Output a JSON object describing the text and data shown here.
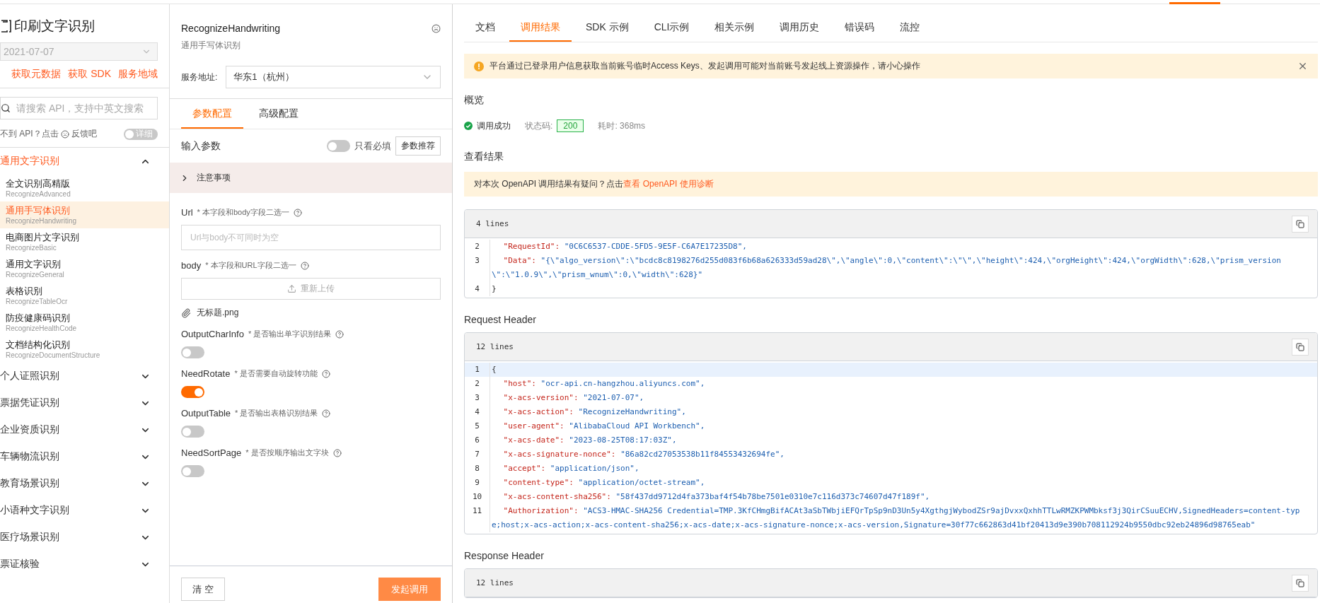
{
  "sidebar": {
    "product_title": "印刷文字识别",
    "version": "2021-07-07",
    "links": [
      "获取元数据",
      "获取 SDK",
      "服务地域"
    ],
    "search": {
      "placeholder": "请搜索 API，支持中英文搜索"
    },
    "feedback": {
      "prefix": "不到 API？点击",
      "suffix": "反馈吧"
    },
    "detail_toggle": {
      "label": "详细",
      "on": false
    },
    "groups": [
      {
        "label": "通用文字识别",
        "expanded": true,
        "children": [
          {
            "title": "全文识别高精版",
            "api": "RecognizeAdvanced",
            "selected": false
          },
          {
            "title": "通用手写体识别",
            "api": "RecognizeHandwriting",
            "selected": true
          },
          {
            "title": "电商图片文字识别",
            "api": "RecognizeBasic",
            "selected": false
          },
          {
            "title": "通用文字识别",
            "api": "RecognizeGeneral",
            "selected": false
          },
          {
            "title": "表格识别",
            "api": "RecognizeTableOcr",
            "selected": false
          },
          {
            "title": "防疫健康码识别",
            "api": "RecognizeHealthCode",
            "selected": false
          },
          {
            "title": "文档结构化识别",
            "api": "RecognizeDocumentStructure",
            "selected": false
          }
        ]
      },
      {
        "label": "个人证照识别",
        "expanded": false
      },
      {
        "label": "票据凭证识别",
        "expanded": false
      },
      {
        "label": "企业资质识别",
        "expanded": false
      },
      {
        "label": "车辆物流识别",
        "expanded": false
      },
      {
        "label": "教育场景识别",
        "expanded": false
      },
      {
        "label": "小语种文字识别",
        "expanded": false
      },
      {
        "label": "医疗场景识别",
        "expanded": false
      },
      {
        "label": "票证核验",
        "expanded": false
      }
    ]
  },
  "api_panel": {
    "title": "RecognizeHandwriting",
    "subtitle": "通用手写体识别",
    "endpoint": {
      "label": "服务地址:",
      "value": "华东1（杭州）"
    },
    "tabs": [
      {
        "label": "参数配置",
        "selected": true
      },
      {
        "label": "高级配置",
        "selected": false
      }
    ],
    "input_params": {
      "label": "输入参数",
      "required_only": {
        "label": "只看必填",
        "on": false
      },
      "recommend_button": "参数推荐"
    },
    "notes": {
      "label": "注意事项",
      "expanded": false
    },
    "params": [
      {
        "kind": "text",
        "name": "Url",
        "note": "* 本字段和body字段二选一",
        "placeholder": "Url与body不可同时为空"
      },
      {
        "kind": "file",
        "name": "body",
        "note": "* 本字段和URL字段二选一",
        "button": "重新上传",
        "file": "无标题.png"
      },
      {
        "kind": "switch",
        "name": "OutputCharInfo",
        "note": "* 是否输出单字识别结果",
        "on": false
      },
      {
        "kind": "switch",
        "name": "NeedRotate",
        "note": "* 是否需要自动旋转功能",
        "on": true
      },
      {
        "kind": "switch",
        "name": "OutputTable",
        "note": "* 是否输出表格识别结果",
        "on": false
      },
      {
        "kind": "switch",
        "name": "NeedSortPage",
        "note": "* 是否按顺序输出文字块",
        "on": false
      }
    ],
    "buttons": {
      "clear": "清 空",
      "invoke": "发起调用"
    }
  },
  "result_panel": {
    "tabs": [
      {
        "label": "文档",
        "selected": false
      },
      {
        "label": "调用结果",
        "selected": true
      },
      {
        "label": "SDK 示例",
        "selected": false
      },
      {
        "label": "CLI示例",
        "selected": false
      },
      {
        "label": "相关示例",
        "selected": false
      },
      {
        "label": "调用历史",
        "selected": false
      },
      {
        "label": "错误码",
        "selected": false
      },
      {
        "label": "流控",
        "selected": false
      }
    ],
    "warning": "平台通过已登录用户信息获取当前账号临时Access Keys、发起调用可能对当前账号发起线上资源操作，请小心操作",
    "overview": {
      "title": "概览",
      "status": "调用成功",
      "status_code_label": "状态码:",
      "status_code": "200",
      "elapsed": "耗时: 368ms"
    },
    "results_title": "查看结果",
    "diagnosis": {
      "text": "对本次 OpenAPI 调用结果有疑问？点击",
      "link": "查看 OpenAPI 使用诊断"
    },
    "blocks": [
      {
        "line_count": "4 lines",
        "lines": [
          {
            "number": "2",
            "kind": "pair",
            "key": "\"RequestId\":",
            "value": "\"0C6C6537-CDDE-5FD5-9E5F-C6A7E17235D8\","
          },
          {
            "number": "3",
            "kind": "pair",
            "key": "\"Data\":",
            "value": "\"{\\\"algo_version\\\":\\\"bcdc8c8198276d255d083f6b68a626333d59ad28\\\",\\\"angle\\\":0,\\\"content\\\":\\\"\\\",\\\"height\\\":424,\\\"orgHeight\\\":424,\\\"orgWidth\\\":628,\\\"prism_version\\\":\\\"1.0.9\\\",\\\"prism_wnum\\\":0,\\\"width\\\":628}\""
          },
          {
            "number": "4",
            "kind": "brace",
            "text": "}"
          }
        ]
      },
      {
        "title": "Request Header",
        "line_count": "12 lines",
        "lines": [
          {
            "number": "1",
            "kind": "brace",
            "text": "{",
            "highlighted": true
          },
          {
            "number": "2",
            "kind": "pair",
            "key": "\"host\":",
            "value": "\"ocr-api.cn-hangzhou.aliyuncs.com\","
          },
          {
            "number": "3",
            "kind": "pair",
            "key": "\"x-acs-version\":",
            "value": "\"2021-07-07\","
          },
          {
            "number": "4",
            "kind": "pair",
            "key": "\"x-acs-action\":",
            "value": "\"RecognizeHandwriting\","
          },
          {
            "number": "5",
            "kind": "pair",
            "key": "\"user-agent\":",
            "value": "\"AlibabaCloud API Workbench\","
          },
          {
            "number": "6",
            "kind": "pair",
            "key": "\"x-acs-date\":",
            "value": "\"2023-08-25T08:17:03Z\","
          },
          {
            "number": "7",
            "kind": "pair",
            "key": "\"x-acs-signature-nonce\":",
            "value": "\"86a82cd27053538b11f84553432694fe\","
          },
          {
            "number": "8",
            "kind": "pair",
            "key": "\"accept\":",
            "value": "\"application/json\","
          },
          {
            "number": "9",
            "kind": "pair",
            "key": "\"content-type\":",
            "value": "\"application/octet-stream\","
          },
          {
            "number": "10",
            "kind": "pair",
            "key": "\"x-acs-content-sha256\":",
            "value": "\"58f437dd9712d4fa373baf4f54b78be7501e0310e7c116d373c74607d47f189f\","
          },
          {
            "number": "11",
            "kind": "pair",
            "key": "\"Authorization\":",
            "value": "\"ACS3-HMAC-SHA256 Credential=TMP.3KfCHmgBifACAt3aSbTWbjiEFQrTpSp9nD3Un5y4XgthgjWybodZSr9ajDvxxQxhhTTLwRMZKPWMbksf3j3QirCSuuECHV,SignedHeaders=content-type;host;x-acs-action;x-acs-content-sha256;x-acs-date;x-acs-signature-nonce;x-acs-version,Signature=30f77c662863d41bf20413d9e390b708112924b9550dbc92eb24896d98765eab\""
          }
        ]
      },
      {
        "title": "Response Header",
        "line_count": "12 lines"
      }
    ]
  }
}
